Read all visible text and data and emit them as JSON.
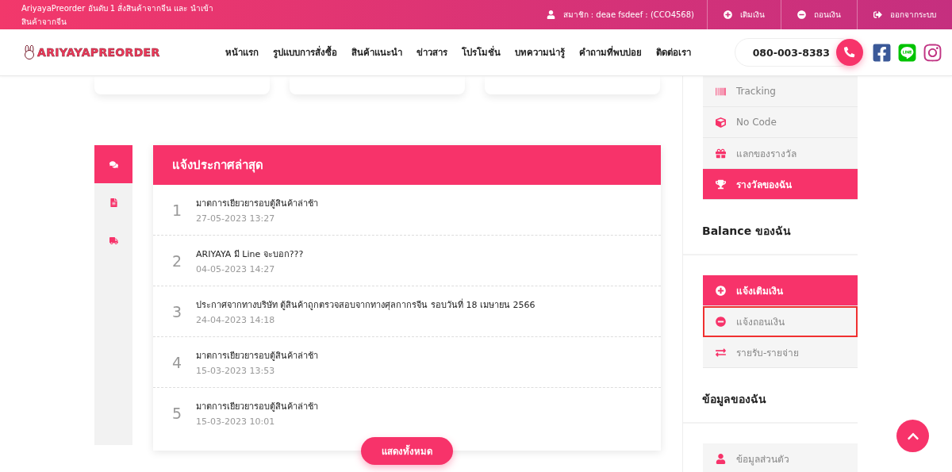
{
  "top_bar": {
    "tagline": "AriyayaPreorder อันดับ 1 สั่งสินค้าจากจีน และ นำเข้าสินค้าจากจีน",
    "member": "สมาชิก : deae fsdeef : (CCO4568)",
    "links": [
      {
        "label": "เติมเงิน",
        "kind": "topup"
      },
      {
        "label": "ถอนเงิน",
        "kind": "withdraw"
      },
      {
        "label": "ออกจากระบบ",
        "kind": "logout"
      }
    ]
  },
  "nav": {
    "logo": "ARIYAYAPREORDER",
    "menu": [
      "หน้าแรก",
      "รูปแบบการสั่งซื้อ",
      "สินค้าแนะนำ",
      "ข่าวสาร",
      "โปรโมชั่น",
      "บทความน่ารู้",
      "คำถามที่พบบ่อย",
      "ติดต่อเรา"
    ],
    "phone": "080-003-8383"
  },
  "announcements": {
    "side_tabs": [
      {
        "kind": "chat",
        "selected": true
      },
      {
        "kind": "file",
        "selected": false
      },
      {
        "kind": "truck",
        "selected": false
      }
    ],
    "title": "แจ้งประกาศล่าสุด",
    "items": [
      {
        "number": "1",
        "title": "มาตการเยียวยารอบตู้สินค้าล่าช้า",
        "date": "27-05-2023 13:27"
      },
      {
        "number": "2",
        "title": "ARIYAYA มี Line จะบอก???",
        "date": "04-05-2023 14:27"
      },
      {
        "number": "3",
        "title": "ประกาศจากทางบริษัท ตู้สินค้าถูกตรวจสอบจากทางศุลกากรจีน รอบวันที่ 18 เมษายน 2566",
        "date": "24-04-2023 14:18"
      },
      {
        "number": "4",
        "title": "มาตการเยียวยารอบตู้สินค้าล่าช้า",
        "date": "15-03-2023 13:53"
      },
      {
        "number": "5",
        "title": "มาตการเยียวยารอบตู้สินค้าล่าช้า",
        "date": "15-03-2023 10:01"
      }
    ],
    "show_all": "แสดงทั้งหมด"
  },
  "sidebar": {
    "sections": [
      {
        "items": [
          {
            "label": "Tracking",
            "kind": "barcode",
            "selected": false,
            "highlighted": false
          },
          {
            "label": "No Code",
            "kind": "cube",
            "selected": false,
            "highlighted": false
          },
          {
            "label": "แลกของรางวัล",
            "kind": "gift",
            "selected": false,
            "highlighted": false
          },
          {
            "label": "รางวัลของฉัน",
            "kind": "trophy",
            "selected": true,
            "highlighted": false
          }
        ]
      },
      {
        "heading": "Balance ของฉัน",
        "items": [
          {
            "label": "แจ้งเติมเงิน",
            "kind": "plus",
            "selected": true,
            "highlighted": false
          },
          {
            "label": "แจ้งถอนเงิน",
            "kind": "minus",
            "selected": false,
            "highlighted": true
          },
          {
            "label": "รายรับ-รายจ่าย",
            "kind": "exchange",
            "selected": false,
            "highlighted": false
          }
        ]
      },
      {
        "heading": "ข้อมูลของฉัน",
        "items": [
          {
            "label": "ข้อมูลส่วนตัว",
            "kind": "user",
            "selected": false,
            "highlighted": false
          }
        ]
      }
    ]
  }
}
